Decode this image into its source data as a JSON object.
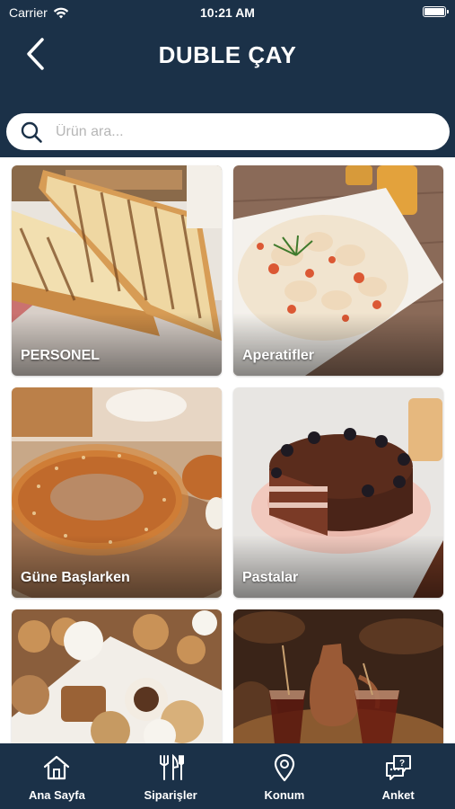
{
  "status_bar": {
    "carrier": "Carrier",
    "time": "10:21 AM"
  },
  "header": {
    "title": "DUBLE ÇAY",
    "back_icon": "chevron-left-icon"
  },
  "search": {
    "placeholder": "Ürün ara...",
    "value": "",
    "icon": "search-icon"
  },
  "categories": [
    {
      "label": "PERSONEL",
      "image": "grilled-toast-sandwich"
    },
    {
      "label": "Aperatifler",
      "image": "manti-dumplings"
    },
    {
      "label": "Güne Başlarken",
      "image": "simit-bagel"
    },
    {
      "label": "Pastalar",
      "image": "chocolate-berry-cake"
    },
    {
      "label": "",
      "image": "assorted-cookies"
    },
    {
      "label": "",
      "image": "turkish-tea-glasses"
    }
  ],
  "tabbar": {
    "items": [
      {
        "label": "Ana Sayfa",
        "icon": "home-icon"
      },
      {
        "label": "Siparişler",
        "icon": "fork-knife-icon"
      },
      {
        "label": "Konum",
        "icon": "location-pin-icon"
      },
      {
        "label": "Anket",
        "icon": "survey-chat-icon"
      }
    ]
  },
  "colors": {
    "brand_navy": "#1b3148",
    "content_bg": "#ffffff",
    "search_bg": "#ffffff",
    "placeholder": "#b6b6b6"
  }
}
